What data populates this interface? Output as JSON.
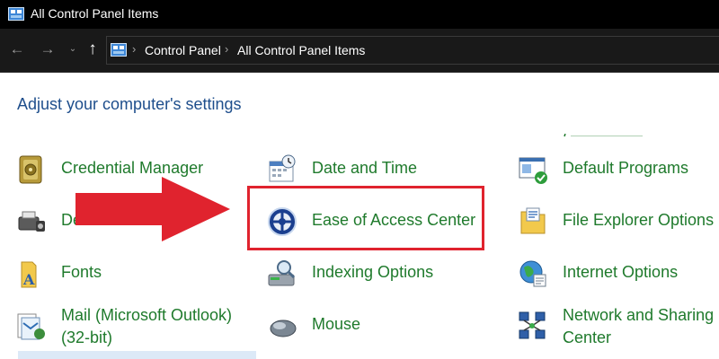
{
  "window": {
    "title": "All Control Panel Items",
    "app_icon": "control-panel-icon"
  },
  "nav": {
    "back_glyph": "←",
    "forward_glyph": "→",
    "recent_glyph": "⌄",
    "up_glyph": "↑",
    "breadcrumb": [
      "Control Panel",
      "All Control Panel Items"
    ],
    "separator": "›"
  },
  "heading": "Adjust your computer's settings",
  "items": {
    "credential_manager": {
      "label": "Credential Manager",
      "icon": "vault-icon"
    },
    "devices": {
      "label": "De",
      "icon": "devices-printers-icon"
    },
    "fonts": {
      "label": "Fonts",
      "icon": "fonts-folder-icon"
    },
    "mail": {
      "label": "Mail (Microsoft Outlook) (32-bit)",
      "icon": "mail-icon"
    },
    "date_time": {
      "label": "Date and Time",
      "icon": "calendar-clock-icon"
    },
    "ease_of_access": {
      "label": "Ease of Access Center",
      "icon": "ease-of-access-icon"
    },
    "indexing": {
      "label": "Indexing Options",
      "icon": "indexing-icon"
    },
    "mouse": {
      "label": "Mouse",
      "icon": "mouse-icon"
    },
    "default_programs": {
      "label": "Default Programs",
      "icon": "default-programs-icon"
    },
    "file_explorer": {
      "label": "File Explorer Options",
      "icon": "folder-options-icon"
    },
    "internet": {
      "label": "Internet Options",
      "icon": "globe-icon"
    },
    "network": {
      "label": "Network and Sharing Center",
      "icon": "network-icon"
    }
  },
  "annotation": {
    "box_color": "#e0232e",
    "arrow_color": "#e0232e"
  },
  "colors": {
    "link_green": "#1f7a2c",
    "heading_blue": "#1e4e8c"
  }
}
